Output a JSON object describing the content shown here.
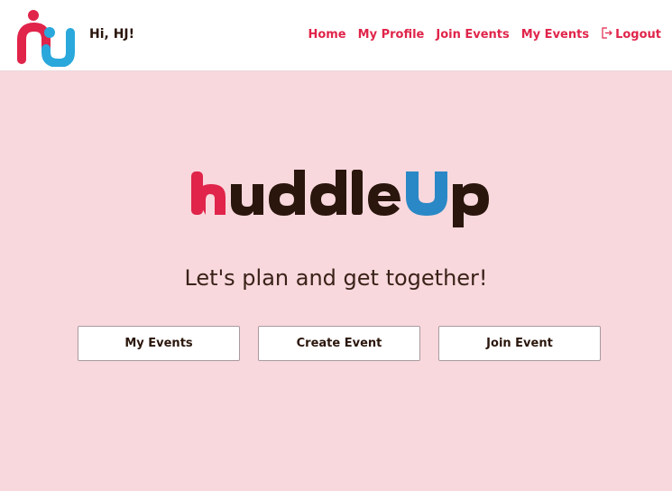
{
  "header": {
    "logo_icon": "huddleup-people-logo",
    "greeting": "Hi, HJ!",
    "nav": {
      "home": "Home",
      "my_profile": "My Profile",
      "join_events": "Join Events",
      "my_events": "My Events",
      "logout": "Logout",
      "logout_icon": "logout-icon"
    }
  },
  "main": {
    "brand_text": "huddleUp",
    "tagline": "Let's plan and get together!",
    "buttons": {
      "my_events": "My Events",
      "create_event": "Create Event",
      "join_event": "Join Event"
    }
  },
  "colors": {
    "background": "#f8d8dd",
    "accent_red": "#e0244a",
    "accent_blue": "#2a88c6",
    "dark_brown": "#2a160c"
  }
}
